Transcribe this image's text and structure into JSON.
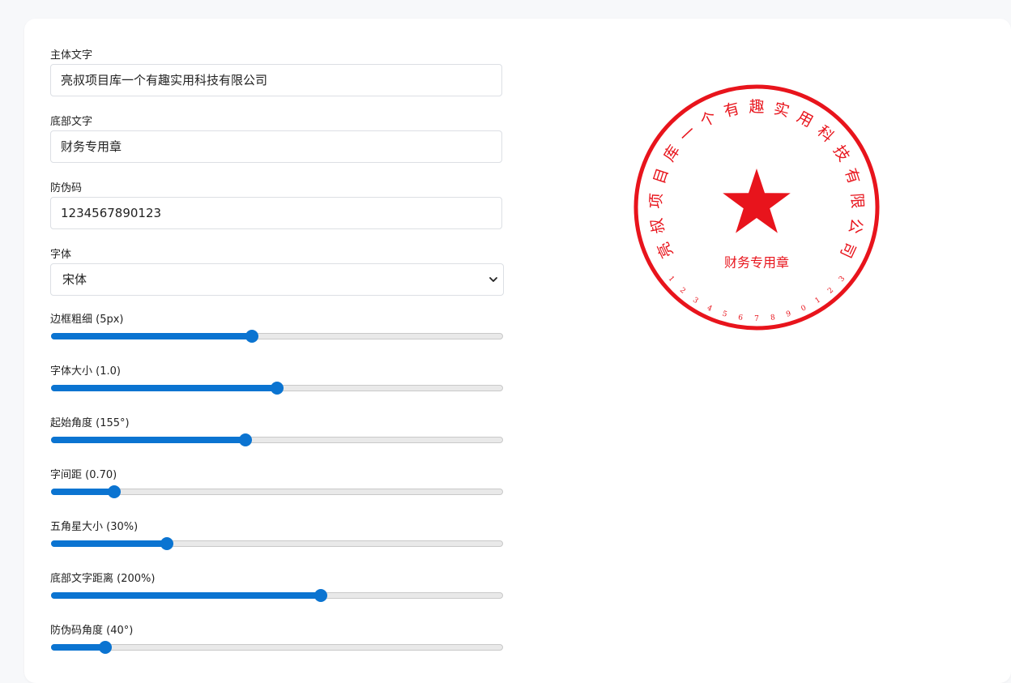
{
  "form": {
    "main_text": {
      "label": "主体文字",
      "value": "亮叔项目库一个有趣实用科技有限公司"
    },
    "bottom_text": {
      "label": "底部文字",
      "value": "财务专用章"
    },
    "security_code": {
      "label": "防伪码",
      "value": "1234567890123"
    },
    "font": {
      "label": "字体",
      "value": "宋体"
    }
  },
  "sliders": [
    {
      "label": "边框粗细 (5px)",
      "fraction": 0.445
    },
    {
      "label": "字体大小 (1.0)",
      "fraction": 0.5
    },
    {
      "label": "起始角度 (155°)",
      "fraction": 0.43
    },
    {
      "label": "字间距 (0.70)",
      "fraction": 0.14
    },
    {
      "label": "五角星大小 (30%)",
      "fraction": 0.257
    },
    {
      "label": "底部文字距离 (200%)",
      "fraction": 0.597
    },
    {
      "label": "防伪码角度 (40°)",
      "fraction": 0.12
    }
  ],
  "seal": {
    "color": "#e8141c",
    "main_text": "亮叔项目库一个有趣实用科技有限公司",
    "bottom_text": "财务专用章",
    "security_code": "1234567890123"
  },
  "colors": {
    "accent": "#0b74d1",
    "seal_red": "#e8141c"
  }
}
